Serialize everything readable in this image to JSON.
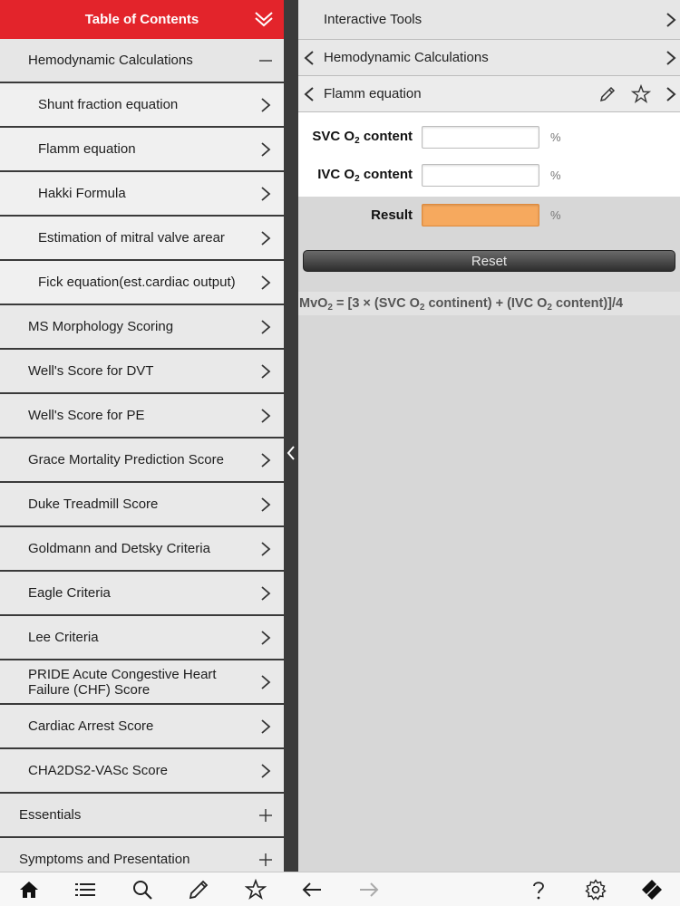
{
  "toc": {
    "title": "Table of Contents",
    "items": [
      {
        "label": "Hemodynamic Calculations",
        "kind": "group",
        "indicator": "minus"
      },
      {
        "label": "Shunt fraction equation",
        "kind": "sub"
      },
      {
        "label": "Flamm equation",
        "kind": "sub"
      },
      {
        "label": "Hakki Formula",
        "kind": "sub"
      },
      {
        "label": "Estimation of mitral valve arear",
        "kind": "sub"
      },
      {
        "label": "Fick equation(est.cardiac output)",
        "kind": "sub"
      },
      {
        "label": "MS Morphology Scoring",
        "kind": "top"
      },
      {
        "label": "Well's Score for DVT",
        "kind": "top"
      },
      {
        "label": "Well's Score for PE",
        "kind": "top"
      },
      {
        "label": "Grace Mortality Prediction Score",
        "kind": "top"
      },
      {
        "label": "Duke Treadmill Score",
        "kind": "top"
      },
      {
        "label": "Goldmann and Detsky Criteria",
        "kind": "top"
      },
      {
        "label": "Eagle Criteria",
        "kind": "top"
      },
      {
        "label": "Lee Criteria",
        "kind": "top"
      },
      {
        "label": "PRIDE Acute Congestive Heart Failure (CHF) Score",
        "kind": "top"
      },
      {
        "label": "Cardiac Arrest Score",
        "kind": "top"
      },
      {
        "label": "CHA2DS2-VASc Score",
        "kind": "top"
      },
      {
        "label": "Essentials",
        "kind": "section",
        "indicator": "plus"
      },
      {
        "label": "Symptoms and Presentation",
        "kind": "section",
        "indicator": "plus"
      }
    ]
  },
  "nav": {
    "level1": "Interactive Tools",
    "level2": "Hemodynamic Calculations",
    "level3": "Flamm equation"
  },
  "calculator": {
    "svc_label_main": "SVC O",
    "svc_label_sub": "2",
    "svc_label_tail": " content",
    "ivc_label_main": "IVC O",
    "ivc_label_sub": "2",
    "ivc_label_tail": " content",
    "result_label": "Result",
    "unit": "%",
    "svc_value": "",
    "ivc_value": "",
    "result_value": "",
    "reset_label": "Reset"
  },
  "formula": {
    "p1": "MvO",
    "s1": "2",
    "p2": " = [3 × (SVC O",
    "s2": "2",
    "p3": " continent) + (IVC O",
    "s3": "2",
    "p4": " content)]/4"
  },
  "toolbar": [
    "home-icon",
    "list-icon",
    "search-icon",
    "pencil-icon",
    "star-icon",
    "back-arrow-icon",
    "forward-arrow-icon",
    "help-icon",
    "gear-icon",
    "bookmark-icon"
  ],
  "colors": {
    "header": "#e3242b",
    "result": "#f6a95e"
  }
}
